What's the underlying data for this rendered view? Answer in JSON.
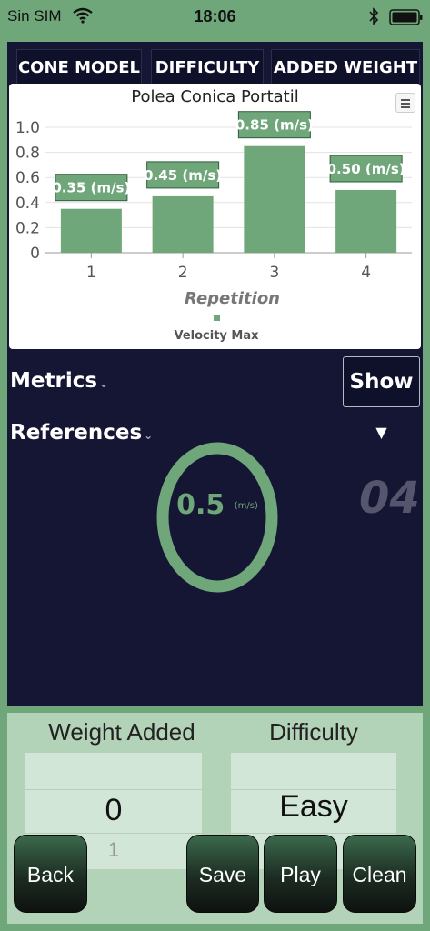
{
  "status_bar": {
    "carrier": "Sin SIM",
    "time": "18:06",
    "icons": [
      "wifi-icon",
      "bluetooth-icon",
      "battery-icon"
    ]
  },
  "top_tabs": [
    {
      "label": "CONE MODEL"
    },
    {
      "label": "DIFFICULTY"
    },
    {
      "label": "ADDED WEIGHT"
    }
  ],
  "chart": {
    "title": "Polea Conica Portatil",
    "menu_icon": "hamburger-menu-icon"
  },
  "chart_data": {
    "type": "bar",
    "title": "Polea Conica Portatil",
    "categories": [
      "1",
      "2",
      "3",
      "4"
    ],
    "series": [
      {
        "name": "Velocity Max",
        "values": [
          0.35,
          0.45,
          0.85,
          0.5
        ]
      }
    ],
    "data_labels": [
      "0.35 (m/s)",
      "0.45 (m/s)",
      "0.85 (m/s)",
      "0.50 (m/s)"
    ],
    "xlabel": "Repetition",
    "ylabel": "",
    "ylim": [
      0,
      1.0
    ],
    "yticks": [
      "0",
      "0.2",
      "0.4",
      "0.6",
      "0.8",
      "1.0"
    ],
    "grid": true,
    "legend": "bottom",
    "color": "#6fa77a"
  },
  "metrics": {
    "label": "Metrics",
    "chevron": "⌄"
  },
  "references": {
    "label": "References",
    "chevron": "⌄"
  },
  "show_button": {
    "label": "Show",
    "icon": "caret-down-icon"
  },
  "gauge": {
    "value": "0.5",
    "unit": "(m/s)",
    "fraction": 1.0
  },
  "rep_counter": "04",
  "pickers": {
    "weight": {
      "header": "Weight Added",
      "value": "0",
      "next": "1"
    },
    "difficulty": {
      "header": "Difficulty",
      "value": "Easy"
    }
  },
  "buttons": {
    "back": "Back",
    "save": "Save",
    "play": "Play",
    "clean": "Clean"
  }
}
